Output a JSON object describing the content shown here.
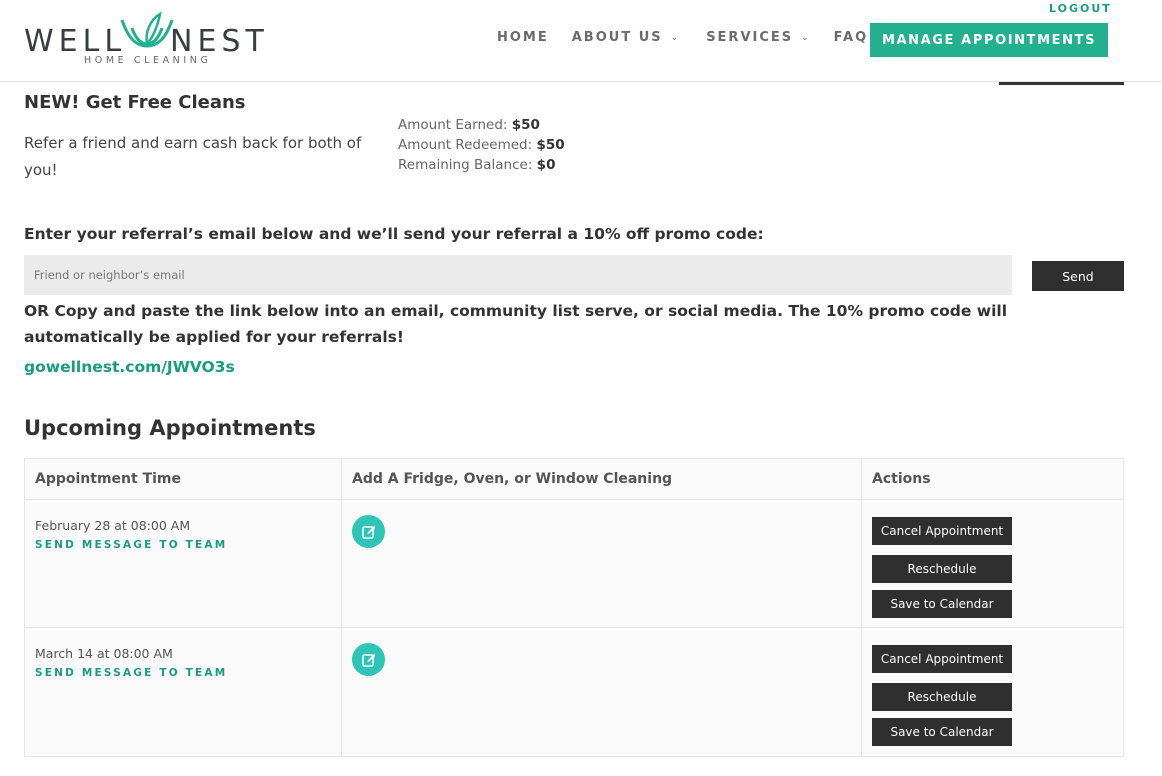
{
  "header": {
    "logo": {
      "left": "WELL",
      "right": "NEST",
      "tagline": "HOME CLEANING"
    },
    "logout": "LOGOUT",
    "nav": [
      {
        "label": "HOME"
      },
      {
        "label": "ABOUT US"
      },
      {
        "label": "SERVICES"
      },
      {
        "label": "FAQ"
      }
    ],
    "manage": "MANAGE APPOINTMENTS"
  },
  "colors": {
    "accent": "#23b08f",
    "link": "#1a9b82",
    "dark_button": "#2f2f2f",
    "icon_circle": "#2ec4b6"
  },
  "referral": {
    "title": "NEW! Get Free Cleans",
    "text": "Refer a friend and earn cash back for both of you!",
    "earned_label": "Amount Earned: ",
    "earned_value": "$50",
    "redeemed_label": "Amount Redeemed: ",
    "redeemed_value": "$50",
    "balance_label": "Remaining Balance: ",
    "balance_value": "$0",
    "email_heading": "Enter your referral’s email below and we’ll send your referral a 10% off promo code:",
    "email_placeholder": "Friend or neighbor’s email",
    "send_label": "Send",
    "copy_text": "OR Copy and paste the link below into an email, community list serve, or social media. The 10% promo code will automatically be applied for your referrals!",
    "link": "gowellnest.com/JWVO3s"
  },
  "appointments": {
    "title": "Upcoming Appointments",
    "columns": [
      "Appointment Time",
      "Add A Fridge, Oven, or Window Cleaning",
      "Actions"
    ],
    "rows": [
      {
        "time": "February 28 at 08:00 AM",
        "message": "SEND MESSAGE TO TEAM",
        "cancel": "Cancel Appointment",
        "reschedule": "Reschedule",
        "calendar": "Save to Calendar",
        "icon": "edit-icon"
      },
      {
        "time": "March 14 at 08:00 AM",
        "message": "SEND MESSAGE TO TEAM",
        "cancel": "Cancel Appointment",
        "reschedule": "Reschedule",
        "calendar": "Save to Calendar",
        "icon": "edit-icon"
      }
    ]
  }
}
